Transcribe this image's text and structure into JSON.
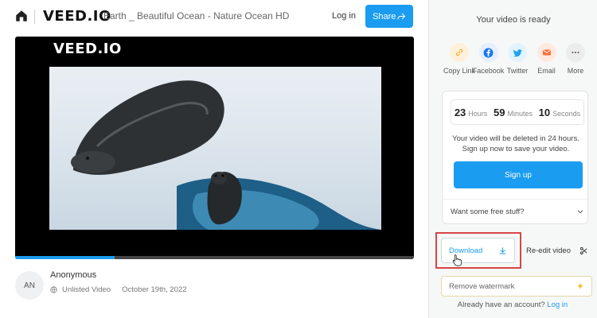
{
  "header": {
    "brand": "VEED.IO",
    "video_title": "Earth _ Beautiful Ocean - Nature Ocean HD",
    "login": "Log in",
    "share": "Share",
    "accent": "#1a9cf0"
  },
  "player": {
    "watermark": "VEED.IO",
    "progress": 0.25
  },
  "author": {
    "initials": "AN",
    "name": "Anonymous",
    "visibility": "Unlisted Video",
    "date": "October 19th, 2022"
  },
  "panel": {
    "ready": "Your video is ready",
    "share_options": [
      {
        "label": "Copy Link",
        "icon": "link-icon",
        "color": "#f7a928"
      },
      {
        "label": "Facebook",
        "icon": "facebook-icon",
        "color": "#1877f2"
      },
      {
        "label": "Twitter",
        "icon": "twitter-icon",
        "color": "#1da1f2"
      },
      {
        "label": "Email",
        "icon": "email-icon",
        "color": "#ff6b35"
      },
      {
        "label": "More",
        "icon": "more-icon",
        "color": "#555555"
      }
    ],
    "timer": {
      "hours": "23",
      "hours_label": "Hours",
      "minutes": "59",
      "minutes_label": "Minutes",
      "seconds": "10",
      "seconds_label": "Seconds"
    },
    "deleted_line1": "Your video will be deleted in 24 hours.",
    "deleted_line2": "Sign up now to save your video.",
    "signup": "Sign up",
    "free_stuff": "Want some free stuff?",
    "download": "Download",
    "reedit": "Re-edit video",
    "remove_watermark": "Remove watermark",
    "account_text": "Already have an account?",
    "account_login": "Log in"
  }
}
